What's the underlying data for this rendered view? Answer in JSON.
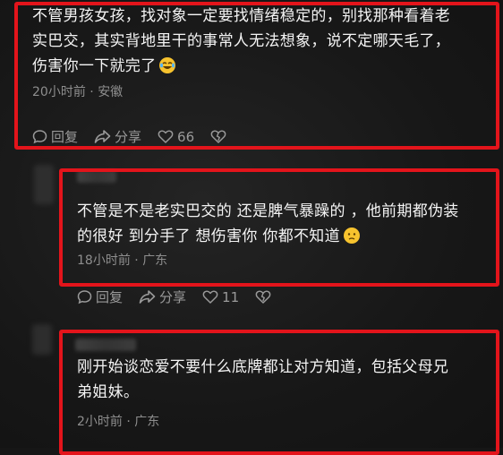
{
  "comments": [
    {
      "text_lines": [
        "不管男孩女孩，找对象一定要找情绪稳定的，别找那种看着老",
        "实巴交，其实背地里干的事常人无法想象，说不定哪天毛了，",
        "伤害你一下就完了"
      ],
      "emoji": "laughing-crying-emoji",
      "time": "20小时前",
      "location": "安徽",
      "reply_label": "回复",
      "share_label": "分享",
      "likes": "66"
    },
    {
      "text_lines": [
        "不管是不是老实巴交的 还是脾气暴躁的 ，他前期都伪装",
        "的很好 到分手了 想伤害你 你都不知道"
      ],
      "emoji": "worried-face-emoji",
      "time": "18小时前",
      "location": "广东",
      "reply_label": "回复",
      "share_label": "分享",
      "likes": "11"
    },
    {
      "text_lines": [
        "刚开始谈恋爱不要什么底牌都让对方知道，包括父母兄",
        "弟姐妹。"
      ],
      "time": "2小时前",
      "location": "广东"
    }
  ],
  "separator": " · ",
  "colors": {
    "highlight": "#e3141b",
    "background": "#161616",
    "text": "#f4f4f4",
    "meta": "#8e8e8e"
  }
}
